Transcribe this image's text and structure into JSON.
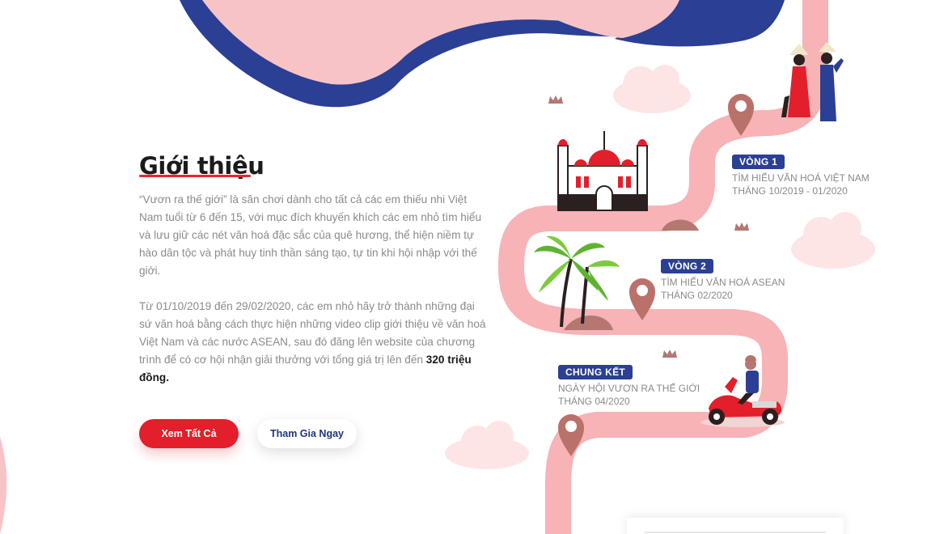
{
  "intro": {
    "title": "Giới thiệu",
    "paragraph_1": "“Vươn ra thế giới” là sân chơi dành cho tất cả các em thiếu nhi Việt Nam tuổi từ 6 đến 15, với mục đích khuyến khích các em nhỏ tìm hiểu và lưu giữ các nét văn hoá đặc sắc của quê hương, thể hiện niềm tự hào dân tộc và phát huy tinh thần sáng tạo, tự tin khi hội nhập với thế giới.",
    "paragraph_2": "Từ 01/10/2019 đến 29/02/2020, các em nhỏ hãy trở thành những đại sứ văn hoá bằng cách thực hiện những video clip giới thiệu về văn hoá Việt Nam và các nước ASEAN, sau đó đăng lên website của chương trình để có cơ hội nhận giải thưởng với tổng giá trị lên đến ",
    "prize": "320 triệu đồng."
  },
  "buttons": {
    "view_all": "Xem Tất Cả",
    "join_now": "Tham Gia Ngay"
  },
  "timeline": {
    "round_1": {
      "badge": "VÒNG 1",
      "name": "TÌM HIỂU VĂN HOÁ VIỆT NAM",
      "date": "THÁNG 10/2019 - 01/2020"
    },
    "round_2": {
      "badge": "VÒNG 2",
      "name": "TÌM HIỂU VĂN HOÁ ASEAN",
      "date": "THÁNG 02/2020"
    },
    "final": {
      "badge": "CHUNG KẾT",
      "name": "NGÀY HỘI VƯƠN RA THẾ GIỚI",
      "date": "THÁNG 04/2020"
    }
  },
  "icons": [
    "location-pin-icon",
    "mosque-icon",
    "palm-tree-icon",
    "scooter-rider-icon",
    "cloud-icon",
    "crown-icon",
    "women-ao-dai-icon"
  ],
  "colors": {
    "accent_red": "#e21f2b",
    "navy": "#2b3f94",
    "pink": "#f7c5c6",
    "road": "#f6b6b8"
  }
}
